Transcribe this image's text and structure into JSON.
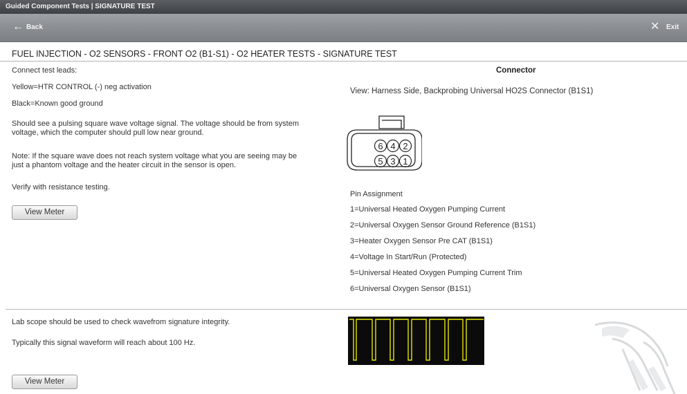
{
  "window": {
    "title": "Guided Component Tests | SIGNATURE TEST"
  },
  "nav": {
    "back_label": "Back",
    "exit_label": "Exit",
    "back_icon": "left-arrow-icon",
    "exit_icon": "close-icon"
  },
  "page": {
    "heading": "FUEL INJECTION - O2 SENSORS - FRONT O2 (B1-S1) - O2 HEATER TESTS - SIGNATURE TEST"
  },
  "instructions": {
    "connect": "Connect test leads:",
    "yellow": "Yellow=HTR CONTROL (-) neg activation",
    "black": "Black=Known good ground",
    "para1_line1": "Should see a pulsing square wave voltage signal. The voltage should be from system",
    "para1_line2": "voltage, which the computer should pull low near ground.",
    "note_line1": "Note: If the square wave does not reach system voltage what you are seeing may be",
    "note_line2": "just a phantom voltage and the heater circuit in the sensor is open.",
    "verify": "Verify with resistance testing.",
    "view_meter_label": "View Meter"
  },
  "connector": {
    "title": "Connector",
    "view": "View: Harness Side, Backprobing Universal HO2S Connector (B1S1)",
    "pins_top": [
      "6",
      "4",
      "2"
    ],
    "pins_bottom": [
      "5",
      "3",
      "1"
    ],
    "pin_assignment_title": "Pin Assignment",
    "pins": [
      "1=Universal Heated Oxygen Pumping Current",
      "2=Universal Oxygen Sensor Ground Reference (B1S1)",
      "3=Heater Oxygen Sensor Pre CAT (B1S1)",
      "4=Voltage In Start/Run (Protected)",
      "5=Universal Heated Oxygen Pumping Current Trim",
      "6=Universal Oxygen Sensor (B1S1)"
    ]
  },
  "scope_section": {
    "line1": "Lab scope should be used to check wavefrom signature integrity.",
    "line2": "Typically this signal waveform will reach about 100 Hz.",
    "view_meter_label": "View Meter",
    "waveform_color": "#e6e600",
    "background_color": "#0b0b0b"
  },
  "colors": {
    "titlebar": "#44484c",
    "navbar": "#8c9094",
    "nav_text": "#f4f4f4",
    "text": "#333333"
  }
}
